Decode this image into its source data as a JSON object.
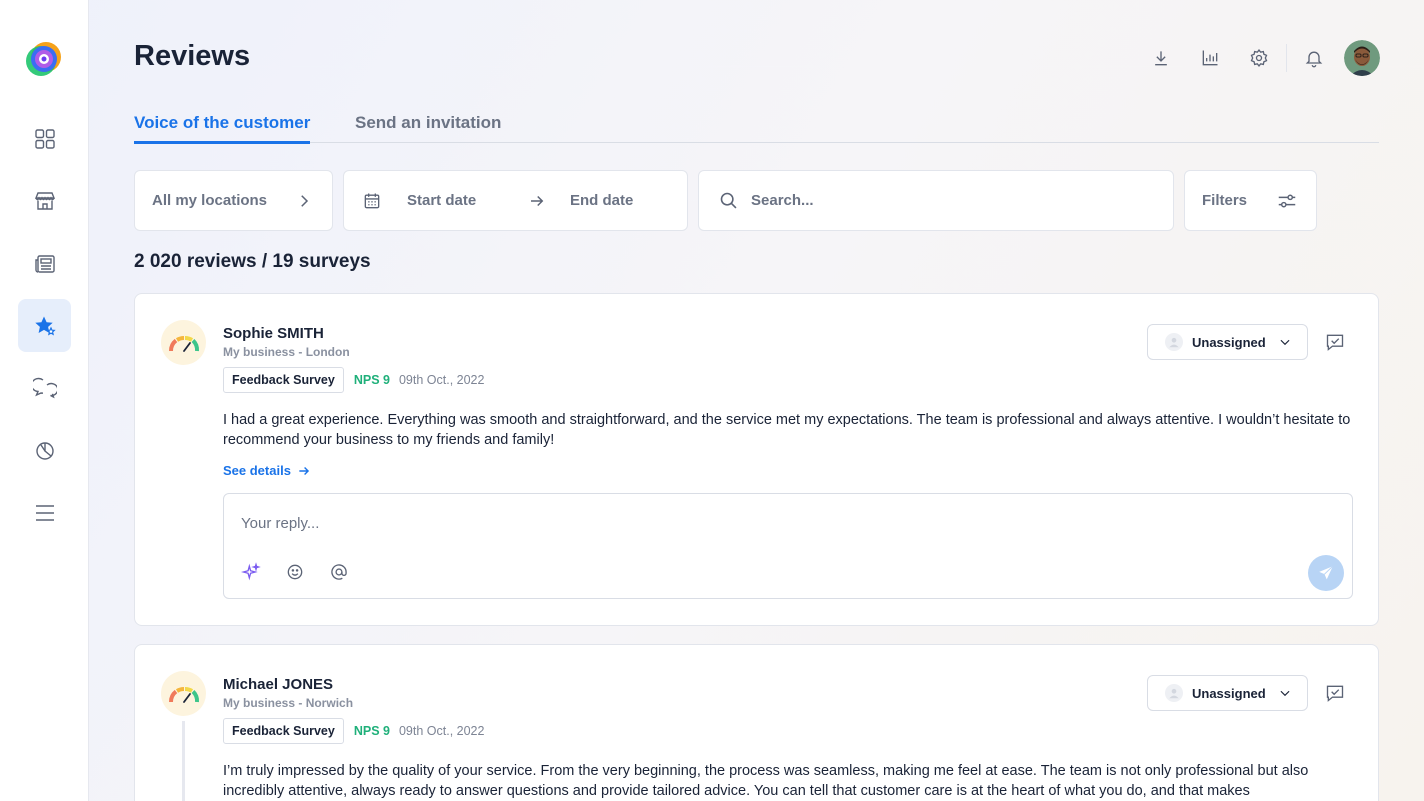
{
  "app": {
    "brand_colors": {
      "accent": "#1a73e8",
      "nps": "#1fb07a"
    }
  },
  "sidebar": {
    "items": [
      {
        "icon": "grid-icon",
        "active": false
      },
      {
        "icon": "store-icon",
        "active": false
      },
      {
        "icon": "newspaper-icon",
        "active": false
      },
      {
        "icon": "star-icon",
        "active": true
      },
      {
        "icon": "chat-icon",
        "active": false
      },
      {
        "icon": "chart-icon",
        "active": false
      },
      {
        "icon": "menu-icon",
        "active": false
      }
    ]
  },
  "header": {
    "title": "Reviews",
    "actions": [
      "download-icon",
      "stats-icon",
      "settings-icon",
      "bell-icon"
    ]
  },
  "tabs": [
    {
      "label": "Voice of the customer",
      "active": true
    },
    {
      "label": "Send an invitation",
      "active": false
    }
  ],
  "filters": {
    "locations": "All my locations",
    "start_date": "Start date",
    "end_date": "End date",
    "search_placeholder": "Search...",
    "filters_label": "Filters"
  },
  "summary": {
    "count_text": "2 020 reviews / 19 surveys"
  },
  "reviews": [
    {
      "author": "Sophie SMITH",
      "business": "My business - London",
      "survey": "Feedback Survey",
      "nps": "NPS 9",
      "date": "09th Oct., 2022",
      "text": "I had a great experience. Everything was smooth and straightforward, and the service met my expectations. The team is professional and always attentive. I wouldn’t hesitate to recommend your business to my friends and family!",
      "see_details": "See details",
      "assignee": "Unassigned",
      "reply_placeholder": "Your reply..."
    },
    {
      "author": "Michael JONES",
      "business": "My business - Norwich",
      "survey": "Feedback Survey",
      "nps": "NPS 9",
      "date": "09th Oct., 2022",
      "text": "I’m truly impressed by the quality of your service. From the very beginning, the process was seamless, making me feel at ease. The team is not only professional but also incredibly attentive, always ready to answer questions and provide tailored advice. You can tell that customer care is at the heart of what you do, and that makes",
      "assignee": "Unassigned"
    }
  ]
}
